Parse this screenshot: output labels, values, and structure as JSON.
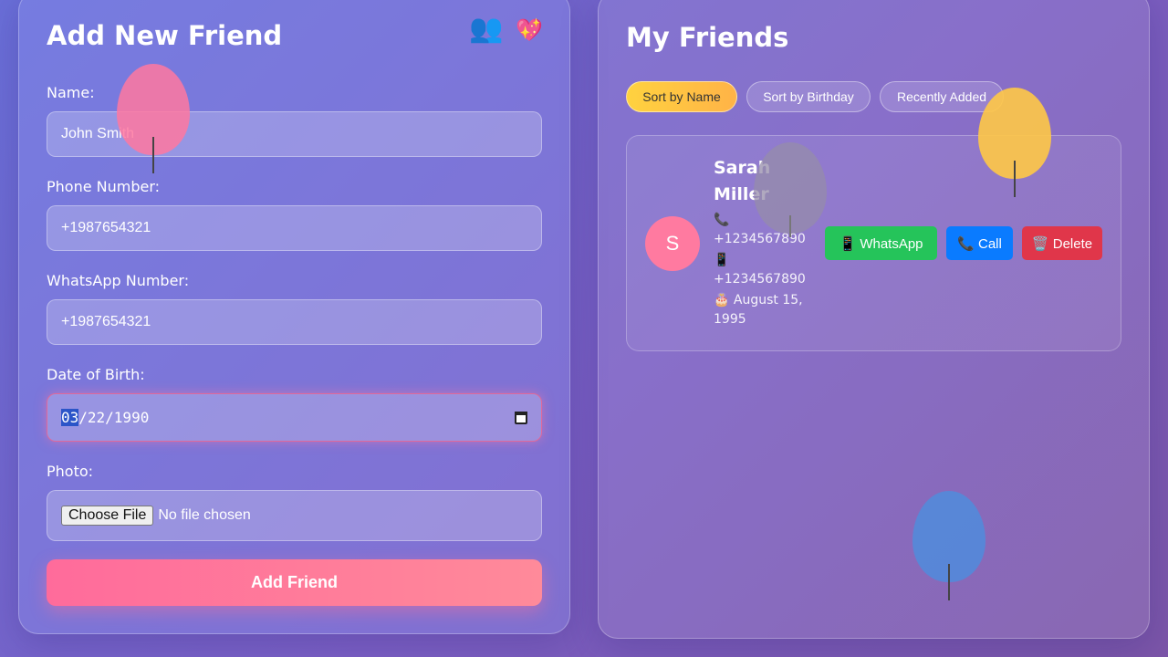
{
  "form": {
    "title": "Add New Friend",
    "icons": [
      "👥",
      "💖"
    ],
    "name_label": "Name:",
    "name_value": "John Smith",
    "phone_label": "Phone Number:",
    "phone_value": "+1987654321",
    "whatsapp_label": "WhatsApp Number:",
    "whatsapp_value": "+1987654321",
    "dob_label": "Date of Birth:",
    "dob_month": "03",
    "dob_rest": "/22/1990",
    "photo_label": "Photo:",
    "choose_file_label": "Choose File",
    "no_file_text": "No file chosen",
    "submit_label": "Add Friend"
  },
  "friends": {
    "title": "My Friends",
    "sort_buttons": [
      "Sort by Name",
      "Sort by Birthday",
      "Recently Added"
    ],
    "list": [
      {
        "initial": "S",
        "name": "Sarah Miller",
        "phone_icon": "📞",
        "phone": "+1234567890",
        "whatsapp_icon": "📱",
        "whatsapp": "+1234567890",
        "birthday": "🎂 August 15, 1995",
        "whatsapp_btn": "📱 WhatsApp",
        "call_btn": "📞 Call",
        "delete_btn": "🗑️ Delete"
      }
    ]
  },
  "colors": {
    "accent_pink": "#ff6b9b",
    "accent_yellow": "#ffd23f",
    "whatsapp": "#25c45a",
    "call": "#0a7bff",
    "delete": "#e0364a"
  }
}
